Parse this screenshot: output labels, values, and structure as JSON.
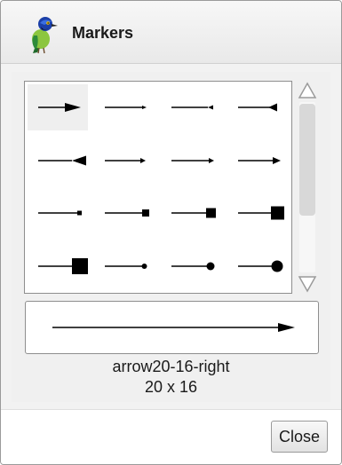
{
  "dialog": {
    "title": "Markers",
    "icon": "green-jay-bird-icon"
  },
  "markers": [
    {
      "id": "arrow20-16-right",
      "shape": "arrow",
      "selected": true
    },
    {
      "id": "marker-small-arrow-1",
      "shape": "arrow"
    },
    {
      "id": "marker-small-arrow-2",
      "shape": "arrow"
    },
    {
      "id": "marker-medium-arrow",
      "shape": "arrow"
    },
    {
      "id": "marker-large-arrow",
      "shape": "arrow"
    },
    {
      "id": "marker-thin-arrow-1",
      "shape": "arrow"
    },
    {
      "id": "marker-thin-arrow-2",
      "shape": "arrow"
    },
    {
      "id": "marker-thin-arrow-3",
      "shape": "arrow"
    },
    {
      "id": "marker-square-xs",
      "shape": "square"
    },
    {
      "id": "marker-square-s",
      "shape": "square"
    },
    {
      "id": "marker-square-m",
      "shape": "square"
    },
    {
      "id": "marker-square-l",
      "shape": "square"
    },
    {
      "id": "marker-square-xl",
      "shape": "square"
    },
    {
      "id": "marker-circle-xs",
      "shape": "circle"
    },
    {
      "id": "marker-circle-s",
      "shape": "circle"
    },
    {
      "id": "marker-circle-m",
      "shape": "circle"
    }
  ],
  "preview": {
    "name": "arrow20-16-right",
    "size": "20 x 16"
  },
  "buttons": {
    "close": "Close"
  },
  "colors": {
    "stroke": "#000000",
    "selected_bg": "#efefef",
    "scroll_arrow": "#9a9a9a"
  }
}
